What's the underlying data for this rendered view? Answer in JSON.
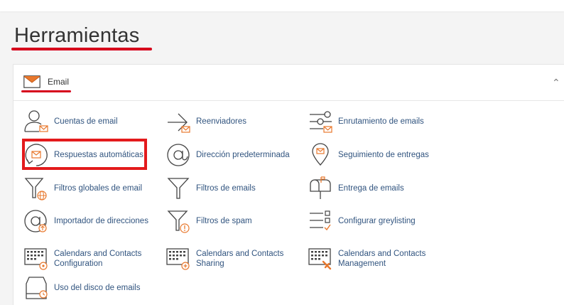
{
  "page": {
    "title": "Herramientas"
  },
  "section": {
    "title": "Email",
    "collapse_icon": "chevron-up-icon"
  },
  "colors": {
    "accent": "#d6001c",
    "icon_orange": "#e8782d",
    "link": "#31547f",
    "highlight": "#e31a1c"
  },
  "tools": {
    "cuentas": {
      "label": "Cuentas de email",
      "icon": "user-mail-icon"
    },
    "reenviadores": {
      "label": "Reenviadores",
      "icon": "forward-arrow-icon"
    },
    "enrutamiento": {
      "label": "Enrutamiento de emails",
      "icon": "routing-icon"
    },
    "respuestas": {
      "label": "Respuestas automáticas",
      "icon": "autoresponder-icon"
    },
    "direccion": {
      "label": "Dirección predeterminada",
      "icon": "at-sign-icon"
    },
    "seguimiento": {
      "label": "Seguimiento de entregas",
      "icon": "location-pin-icon"
    },
    "filtros_globales": {
      "label": "Filtros globales de email",
      "icon": "globe-filter-icon"
    },
    "filtros_emails": {
      "label": "Filtros de emails",
      "icon": "filter-icon"
    },
    "entrega": {
      "label": "Entrega de emails",
      "icon": "mailbox-icon"
    },
    "importador": {
      "label": "Importador de direcciones",
      "icon": "at-import-icon"
    },
    "filtros_spam": {
      "label": "Filtros de spam",
      "icon": "spam-filter-icon"
    },
    "greylisting": {
      "label": "Configurar greylisting",
      "icon": "checklist-icon"
    },
    "cal_config": {
      "line1": "Calendars and Contacts",
      "line2": "Configuration",
      "icon": "calendar-config-icon"
    },
    "cal_sharing": {
      "line1": "Calendars and Contacts",
      "line2": "Sharing",
      "icon": "calendar-sharing-icon"
    },
    "cal_mgmt": {
      "line1": "Calendars and Contacts",
      "line2": "Management",
      "icon": "calendar-management-icon"
    },
    "disco": {
      "label": "Uso del disco de emails",
      "icon": "disk-usage-icon"
    }
  }
}
